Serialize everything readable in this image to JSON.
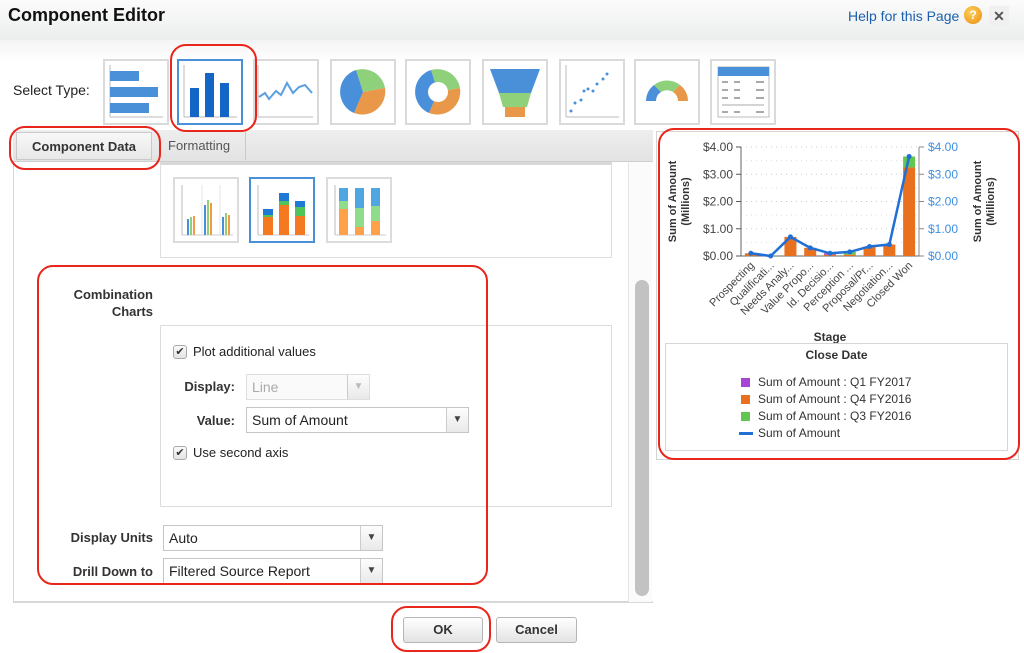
{
  "header": {
    "title": "Component Editor",
    "help_link": "Help for this Page",
    "help_icon": "question-circle-icon",
    "close_icon": "close-x-icon",
    "close_glyph": "✕"
  },
  "type_selector": {
    "label": "Select Type:",
    "selected": "vertical-bar",
    "types": [
      {
        "id": "horizontal-bar",
        "label": "Horizontal Bar Chart"
      },
      {
        "id": "vertical-bar",
        "label": "Vertical Bar Chart"
      },
      {
        "id": "line",
        "label": "Line Chart"
      },
      {
        "id": "pie",
        "label": "Pie Chart"
      },
      {
        "id": "donut",
        "label": "Donut Chart"
      },
      {
        "id": "funnel",
        "label": "Funnel Chart"
      },
      {
        "id": "scatter",
        "label": "Scatter Chart"
      },
      {
        "id": "gauge",
        "label": "Gauge"
      },
      {
        "id": "table",
        "label": "Table"
      }
    ]
  },
  "tabs": [
    {
      "label": "Component Data",
      "active": true
    },
    {
      "label": "Formatting",
      "active": false
    }
  ],
  "subtypes": {
    "selected": "stacked",
    "items": [
      {
        "id": "grouped",
        "label": "Grouped"
      },
      {
        "id": "stacked",
        "label": "Stacked"
      },
      {
        "id": "stacked-100",
        "label": "Stacked to 100%"
      }
    ]
  },
  "combination_charts": {
    "label_line1": "Combination",
    "label_line2": "Charts",
    "plot_additional_values": {
      "label": "Plot additional values",
      "checked": true,
      "mark": "✔"
    },
    "display": {
      "label": "Display:",
      "value": "Line",
      "disabled": true
    },
    "value": {
      "label": "Value:",
      "value": "Sum of Amount"
    },
    "use_second_axis": {
      "label": "Use second axis",
      "checked": true,
      "mark": "✔"
    },
    "arrow": "▼"
  },
  "display_units": {
    "label": "Display Units",
    "value": "Auto"
  },
  "drill_down": {
    "label": "Drill Down to",
    "value": "Filtered Source Report"
  },
  "buttons": {
    "ok": "OK",
    "cancel": "Cancel"
  },
  "colors": {
    "q1_fy2017": "#a646d8",
    "q4_fy2016": "#e8701f",
    "q3_fy2016": "#62c650",
    "line": "#1f6fd6",
    "right_axis": "#3d8fe0",
    "highlight": "#e8261b",
    "selection": "#4a90d9"
  },
  "chart_data": {
    "type": "bar",
    "stacked": true,
    "xlabel": "Stage",
    "ylabel_left": "Sum of Amount (Millions)",
    "ylabel_right": "Sum of Amount (Millions)",
    "ylim": [
      0,
      4
    ],
    "y_ticks": [
      "$0.00",
      "$1.00",
      "$2.00",
      "$3.00",
      "$4.00"
    ],
    "grid": true,
    "categories": [
      "Prospecting",
      "Qualificati...",
      "Needs Analy...",
      "Value Propo...",
      "Id. Decisio...",
      "Perception ...",
      "Proposal/Pr...",
      "Negotiation...",
      "Closed Won"
    ],
    "series": [
      {
        "name": "Sum of Amount : Q1 FY2017",
        "color_key": "q1_fy2017",
        "values": [
          0,
          0,
          0,
          0,
          0.05,
          0,
          0,
          0,
          0
        ]
      },
      {
        "name": "Sum of Amount : Q4 FY2016",
        "color_key": "q4_fy2016",
        "values": [
          0.1,
          0,
          0.7,
          0.3,
          0.05,
          0.05,
          0.35,
          0.42,
          3.25
        ]
      },
      {
        "name": "Sum of Amount : Q3 FY2016",
        "color_key": "q3_fy2016",
        "values": [
          0,
          0,
          0,
          0,
          0,
          0.1,
          0,
          0,
          0.4
        ]
      }
    ],
    "line_series": {
      "name": "Sum of Amount",
      "axis": "right",
      "values": [
        0.1,
        0.0,
        0.7,
        0.3,
        0.1,
        0.15,
        0.35,
        0.42,
        3.65
      ]
    },
    "legend": {
      "title": "Close Date",
      "position": "bottom"
    }
  }
}
